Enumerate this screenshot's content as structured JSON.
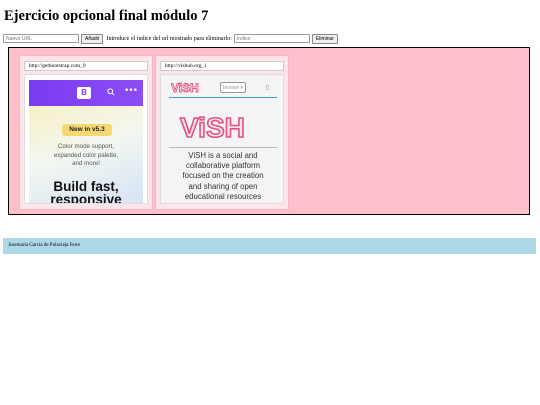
{
  "page": {
    "title": "Ejercicio opcional final módulo 7"
  },
  "controls": {
    "url_placeholder": "Nuevo URL",
    "add_label": "Añadir",
    "index_prompt": "Introduce el índice del url mostrado para eliminarlo:",
    "index_placeholder": "Índice",
    "delete_label": "Eliminar"
  },
  "cards": [
    {
      "url": "http://getbootstrap.com_0",
      "preview": {
        "logo": "B",
        "badge": "New in v5.3",
        "description_lines": [
          "Color mode support,",
          "expanded color palette,",
          "and more!"
        ],
        "headline_lines": [
          "Build fast,",
          "responsive"
        ],
        "accent": "#7a3cf0"
      }
    },
    {
      "url": "http://vishub.org_1",
      "preview": {
        "logo": "ViSH",
        "browse_label": "browse",
        "menu_icon": "menu-icon",
        "description_lines": [
          "ViSH is a social and",
          "collaborative platform",
          "focused on the creation",
          "and sharing of open",
          "educational resources"
        ],
        "accent": "#e0547f"
      }
    }
  ],
  "footer": {
    "text": "Josemaría García de Polavieja Ferre"
  },
  "colors": {
    "gallery_bg": "#ffc0cb",
    "footer_bg": "#add8e6"
  }
}
